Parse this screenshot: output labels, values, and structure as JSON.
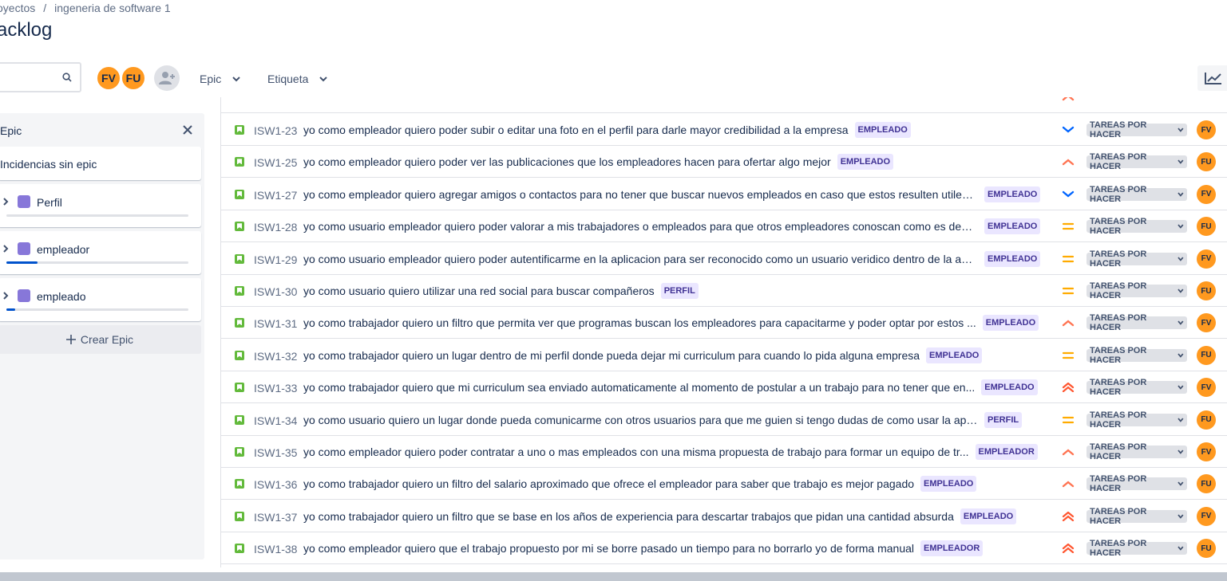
{
  "breadcrumb": {
    "project": "oyectos",
    "separator": "/",
    "board": "ingeneria de software 1"
  },
  "page_title": "acklog",
  "search": {
    "value": "",
    "placeholder": ""
  },
  "filter_avatars": [
    {
      "initials": "FV",
      "color": "#ff991f"
    },
    {
      "initials": "FU",
      "color": "#ff991f"
    }
  ],
  "filters": {
    "epic_label": "Epic",
    "label_label": "Etiqueta"
  },
  "epic_panel": {
    "title": "Epic",
    "no_epic_label": "Incidencias sin epic",
    "epics": [
      {
        "name": "Perfil",
        "color": "#8777d9",
        "progress": 0
      },
      {
        "name": "empleador",
        "color": "#8777d9",
        "progress": 0.17
      },
      {
        "name": "empleado",
        "color": "#8777d9",
        "progress": 0.05
      }
    ],
    "create_label": "Crear Epic"
  },
  "colors": {
    "story": "#63ba3c",
    "avatar": "#ff991f",
    "lozenge_bg": "#eae6ff",
    "lozenge_text": "#403294",
    "priority_low": "#0065ff",
    "priority_medium": "#ffab00",
    "priority_high": "#ff7452",
    "priority_highest": "#ff5630"
  },
  "issues": [
    {
      "key": "ISW1-23",
      "summary": "yo como empleador quiero poder subir o editar una foto en el perfil para darle mayor credibilidad a la empresa",
      "epic": "EMPLEADO",
      "priority": "low",
      "status": "TAREAS POR HACER",
      "assignee": "FV"
    },
    {
      "key": "ISW1-25",
      "summary": "yo como empleador quiero poder ver las publicaciones que los empleadores hacen para ofertar algo mejor",
      "epic": "EMPLEADO",
      "priority": "high",
      "status": "TAREAS POR HACER",
      "assignee": "FU"
    },
    {
      "key": "ISW1-27",
      "summary": "yo como empleador quiero agregar amigos o contactos para no tener que buscar nuevos empleados en caso que estos resulten utiles ...",
      "epic": "EMPLEADO",
      "priority": "low",
      "status": "TAREAS POR HACER",
      "assignee": "FV"
    },
    {
      "key": "ISW1-28",
      "summary": "yo como usuario empleador quiero poder valorar a mis trabajadores o empleados para que otros empleadores conoscan como es dese...",
      "epic": "EMPLEADO",
      "priority": "medium",
      "status": "TAREAS POR HACER",
      "assignee": "FU"
    },
    {
      "key": "ISW1-29",
      "summary": "yo como usuario empleador quiero poder autentificarme en la aplicacion para ser reconocido como un usuario veridico dentro de la apli...",
      "epic": "EMPLEADO",
      "priority": "medium",
      "status": "TAREAS POR HACER",
      "assignee": "FV"
    },
    {
      "key": "ISW1-30",
      "summary": "yo como usuario quiero utilizar una red social para buscar compañeros",
      "epic": "PERFIL",
      "priority": "medium",
      "status": "TAREAS POR HACER",
      "assignee": "FU"
    },
    {
      "key": "ISW1-31",
      "summary": "yo como trabajador quiero un filtro que permita ver que programas buscan los empleadores para capacitarme y poder optar por estos ...",
      "epic": "EMPLEADO",
      "priority": "high",
      "status": "TAREAS POR HACER",
      "assignee": "FV"
    },
    {
      "key": "ISW1-32",
      "summary": "yo como trabajador quiero un lugar dentro de mi perfil donde pueda dejar mi curriculum para cuando lo pida alguna empresa",
      "epic": "EMPLEADO",
      "priority": "medium",
      "status": "TAREAS POR HACER",
      "assignee": "FU"
    },
    {
      "key": "ISW1-33",
      "summary": "yo como trabajador quiero que mi curriculum sea enviado automaticamente al momento de postular a un trabajo para no tener que en...",
      "epic": "EMPLEADO",
      "priority": "highest",
      "status": "TAREAS POR HACER",
      "assignee": "FV"
    },
    {
      "key": "ISW1-34",
      "summary": "yo como usuario quiero un lugar donde pueda comunicarme con otros usuarios para que me guien si tengo dudas de como usar la aplicaci...",
      "epic": "PERFIL",
      "priority": "medium",
      "status": "TAREAS POR HACER",
      "assignee": "FU"
    },
    {
      "key": "ISW1-35",
      "summary": "yo como empleador quiero poder contratar a uno o mas empleados con una misma propuesta de trabajo para formar un equipo de tr...",
      "epic": "EMPLEADOR",
      "priority": "high",
      "status": "TAREAS POR HACER",
      "assignee": "FV"
    },
    {
      "key": "ISW1-36",
      "summary": "yo como trabajador quiero un filtro del salario aproximado que ofrece el empleador para saber que trabajo es mejor pagado",
      "epic": "EMPLEADO",
      "priority": "high",
      "status": "TAREAS POR HACER",
      "assignee": "FU"
    },
    {
      "key": "ISW1-37",
      "summary": "yo como trabajador quiero un filtro que se base en los años de experiencia para descartar trabajos que pidan una cantidad absurda",
      "epic": "EMPLEADO",
      "priority": "highest",
      "status": "TAREAS POR HACER",
      "assignee": "FV"
    },
    {
      "key": "ISW1-38",
      "summary": "yo como empleador quiero que el trabajo propuesto por mi se borre pasado un tiempo para no borrarlo yo de forma manual",
      "epic": "EMPLEADOR",
      "priority": "highest",
      "status": "TAREAS POR HACER",
      "assignee": "FU"
    }
  ]
}
